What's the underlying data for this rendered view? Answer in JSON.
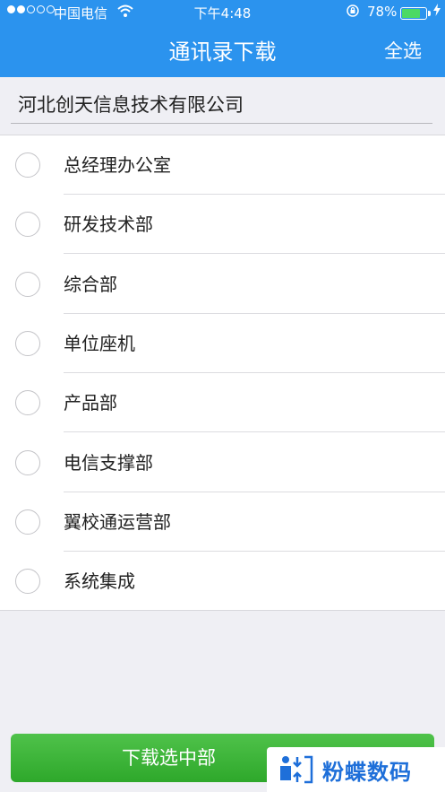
{
  "status_bar": {
    "carrier": "中国电信",
    "time": "下午4:48",
    "battery_pct": "78%",
    "battery_level": 0.78,
    "signal_bars_filled": 2,
    "signal_bars_total": 5,
    "icons": [
      "signal-dots-icon",
      "wifi-icon",
      "rotation-lock-icon",
      "battery-icon",
      "charging-bolt-icon"
    ]
  },
  "nav": {
    "title": "通讯录下载",
    "select_all": "全选"
  },
  "company": {
    "name": "河北创天信息技术有限公司"
  },
  "departments": [
    {
      "label": "总经理办公室",
      "selected": false
    },
    {
      "label": "研发技术部",
      "selected": false
    },
    {
      "label": "综合部",
      "selected": false
    },
    {
      "label": "单位座机",
      "selected": false
    },
    {
      "label": "产品部",
      "selected": false
    },
    {
      "label": "电信支撑部",
      "selected": false
    },
    {
      "label": "翼校通运营部",
      "selected": false
    },
    {
      "label": "系统集成",
      "selected": false
    }
  ],
  "footer": {
    "download_button": "下载选中部"
  },
  "watermark": {
    "text": "粉蝶数码"
  },
  "colors": {
    "nav_blue": "#2b93ee",
    "button_green": "#3ab436",
    "watermark_blue": "#1e6fd9"
  }
}
